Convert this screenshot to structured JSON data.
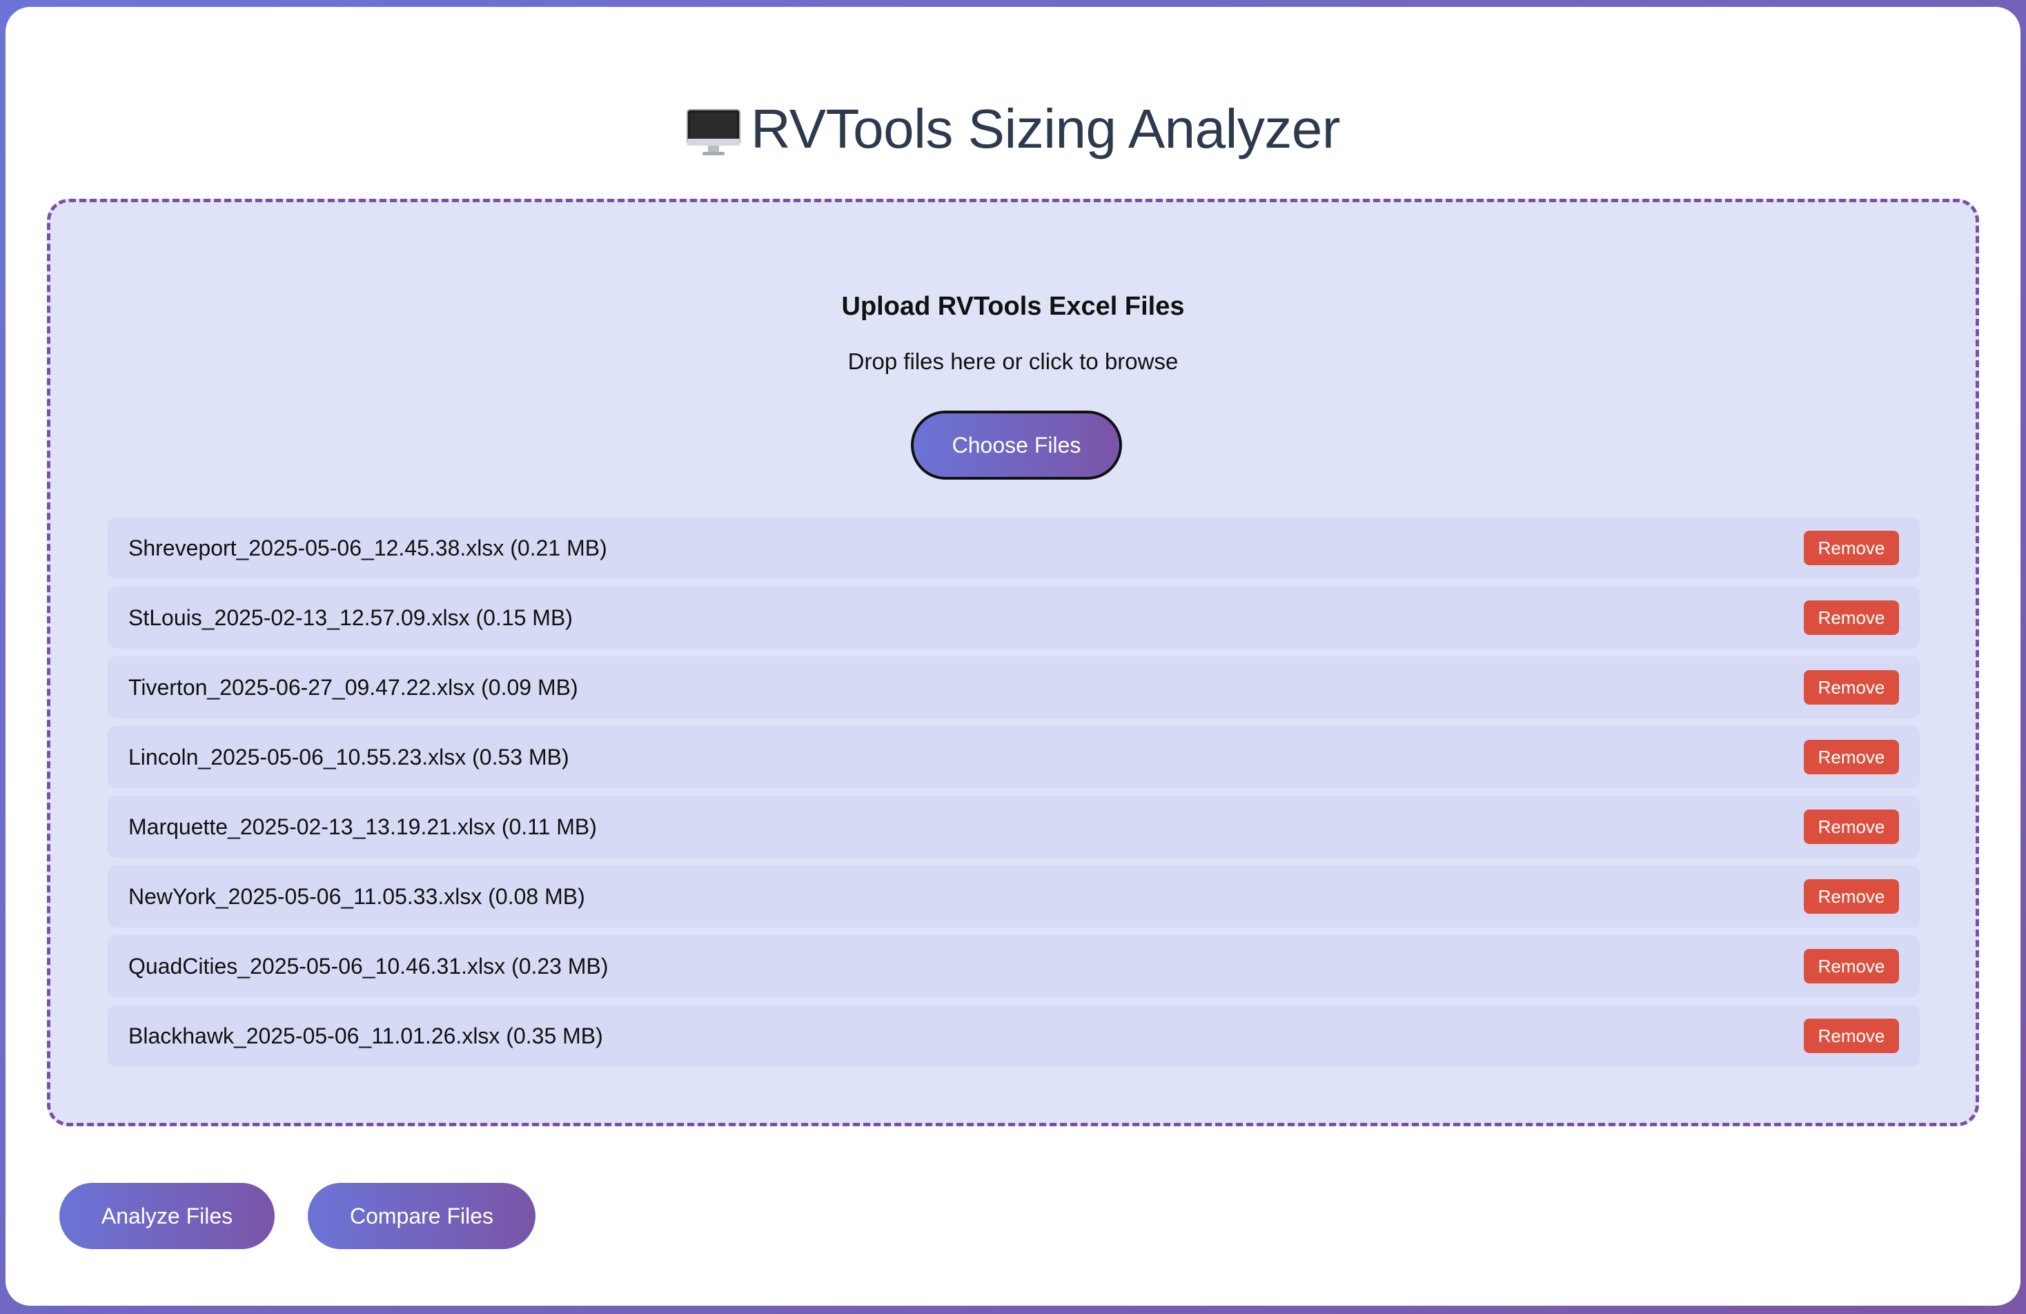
{
  "header": {
    "title": "RVTools Sizing Analyzer",
    "icon": "desktop-computer-icon"
  },
  "upload": {
    "title": "Upload RVTools Excel Files",
    "subtitle": "Drop files here or click to browse",
    "choose_label": "Choose Files"
  },
  "files": [
    {
      "name": "Shreveport_2025-05-06_12.45.38.xlsx (0.21 MB)",
      "remove_label": "Remove"
    },
    {
      "name": "StLouis_2025-02-13_12.57.09.xlsx (0.15 MB)",
      "remove_label": "Remove"
    },
    {
      "name": "Tiverton_2025-06-27_09.47.22.xlsx (0.09 MB)",
      "remove_label": "Remove"
    },
    {
      "name": "Lincoln_2025-05-06_10.55.23.xlsx (0.53 MB)",
      "remove_label": "Remove"
    },
    {
      "name": "Marquette_2025-02-13_13.19.21.xlsx (0.11 MB)",
      "remove_label": "Remove"
    },
    {
      "name": "NewYork_2025-05-06_11.05.33.xlsx (0.08 MB)",
      "remove_label": "Remove"
    },
    {
      "name": "QuadCities_2025-05-06_10.46.31.xlsx (0.23 MB)",
      "remove_label": "Remove"
    },
    {
      "name": "Blackhawk_2025-05-06_11.01.26.xlsx (0.35 MB)",
      "remove_label": "Remove"
    }
  ],
  "actions": {
    "analyze_label": "Analyze Files",
    "compare_label": "Compare Files"
  },
  "colors": {
    "accent_start": "#6b74d6",
    "accent_end": "#7a55a8",
    "dropzone_bg": "#dfe3f8",
    "dropzone_border": "#7d4fa3",
    "remove": "#dc4f3e",
    "title_text": "#2d3a4e"
  }
}
